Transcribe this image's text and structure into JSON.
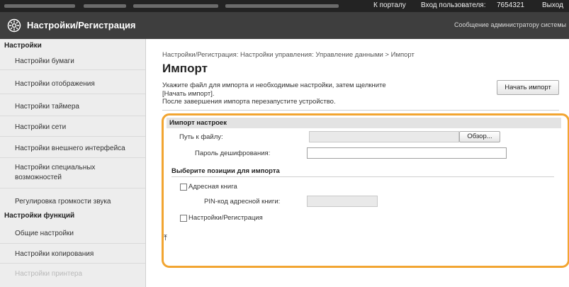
{
  "topbar": {
    "portal_link": "К порталу",
    "login_user_label": "Вход пользователя:",
    "user_id": "7654321",
    "logout_link": "Выход"
  },
  "header": {
    "app_title": "Настройки/Регистрация",
    "admin_message_link": "Сообщение администратору системы",
    "logo_icon": "settings-gear-icon"
  },
  "sidebar": {
    "section1_title": "Настройки",
    "section1_items": [
      "Настройки бумаги",
      "Настройки отображения",
      "Настройки таймера",
      "Настройки сети",
      "Настройки внешнего интерфейса",
      "Настройки специальных",
      "возможностей",
      "Регулировка громкости звука"
    ],
    "section2_title": "Настройки функций",
    "section2_items": [
      "Общие настройки",
      "Настройки копирования",
      "Настройки принтера"
    ]
  },
  "main": {
    "breadcrumb": "Настройки/Регистрация: Настройки управления: Управление данными > Импорт",
    "page_title": "Импорт",
    "instructions": [
      "Укажите файл для импорта и необходимые настройки, затем щелкните",
      "[Начать импорт].",
      "После завершения импорта перезапустите устройство."
    ],
    "start_import_button": "Начать импорт",
    "import_settings_title": "Импорт настроек",
    "file_path_label": "Путь к файлу:",
    "browse_button": "Обзор...",
    "decrypt_password_label": "Пароль дешифрования:",
    "decrypt_password_value": "",
    "select_items_title": "Выберите позиции для импорта",
    "address_book_label": "Адресная книга",
    "address_book_checked": false,
    "address_book_pin_label": "PIN-код адресной книги:",
    "settings_registration_label": "Настройки/Регистрация",
    "settings_registration_checked": false,
    "back_to_top_icon": "top-arrow-icon",
    "back_to_top_glyph": "⤒"
  },
  "colors": {
    "highlight_frame": "#f2a531",
    "header_bg": "#3e3e3e",
    "topbar_bg": "#232323"
  }
}
